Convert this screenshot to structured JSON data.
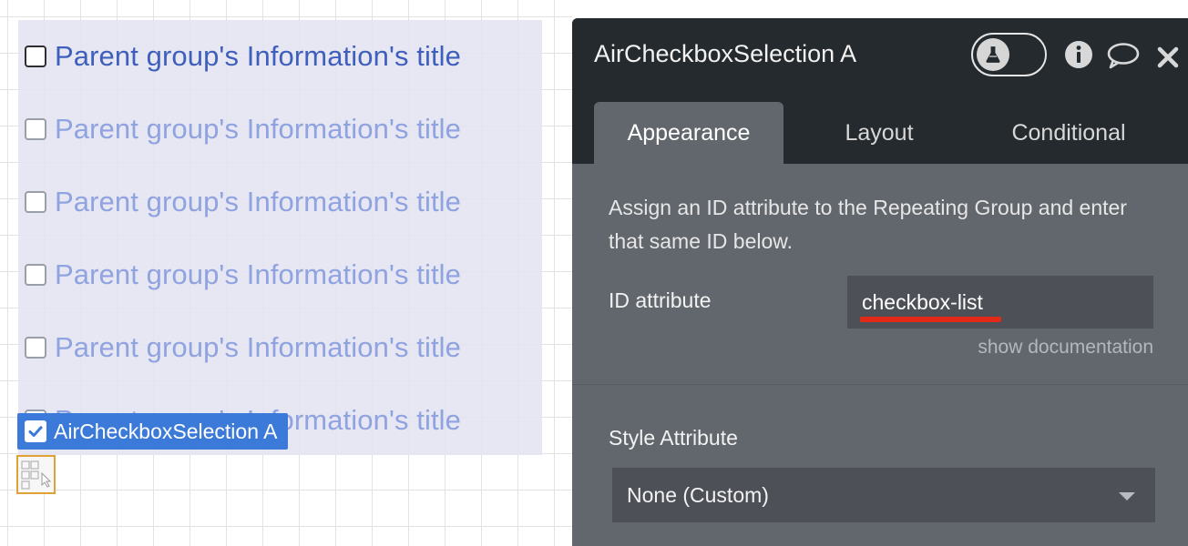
{
  "canvas": {
    "repeating_group": {
      "cells": [
        {
          "label": "Parent group's Information's title"
        },
        {
          "label": "Parent group's Information's title"
        },
        {
          "label": "Parent group's Information's title"
        },
        {
          "label": "Parent group's Information's title"
        },
        {
          "label": "Parent group's Information's title"
        },
        {
          "label": "Parent group's Information's title"
        }
      ]
    },
    "selected_element_label": "AirCheckboxSelection A"
  },
  "panel": {
    "title": "AirCheckboxSelection A",
    "header_icons": [
      "flask-icon",
      "info-icon",
      "comment-icon",
      "close-icon"
    ],
    "tabs": [
      {
        "label": "Appearance",
        "active": true
      },
      {
        "label": "Layout",
        "active": false
      },
      {
        "label": "Conditional",
        "active": false
      }
    ],
    "description": "Assign an ID attribute to the Repeating Group and enter that same ID below.",
    "id_attribute": {
      "label": "ID attribute",
      "value": "checkbox-list"
    },
    "show_documentation": "show documentation",
    "style_attribute": {
      "label": "Style Attribute",
      "selected": "None (Custom)"
    }
  },
  "colors": {
    "panel_header": "#252a2e",
    "panel_body": "#62676d",
    "input_bg": "#4d5157",
    "highlight_underline": "#e32a18",
    "selection_badge": "#3b7ad8",
    "first_label": "#3f5fbd",
    "other_labels": "#8fa3e0"
  }
}
